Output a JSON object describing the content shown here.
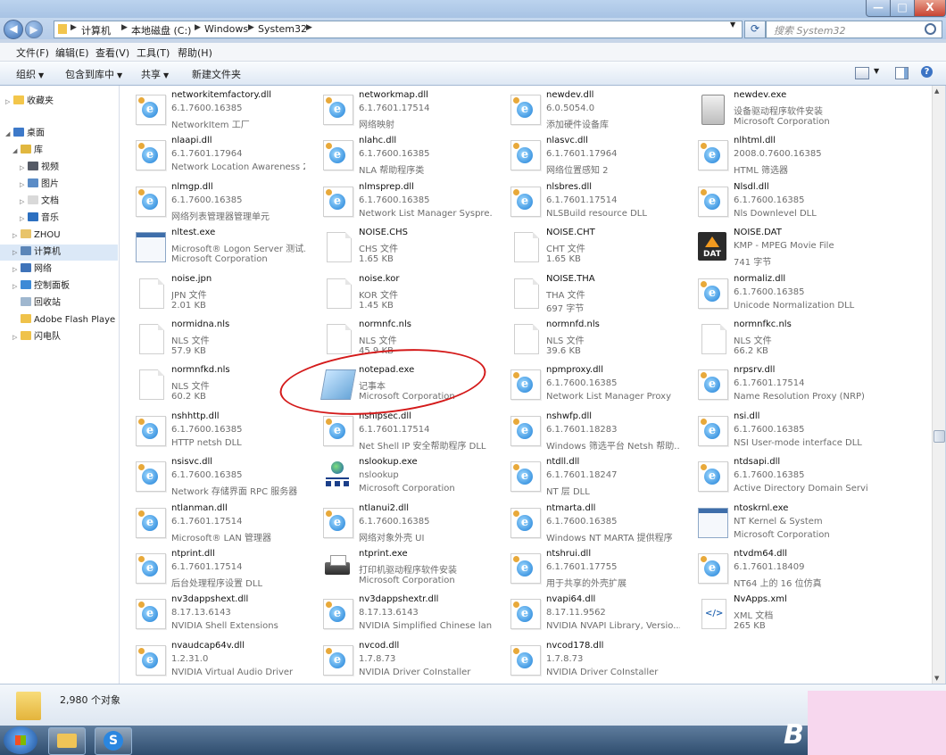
{
  "window": {
    "minimize_label": "—",
    "maximize_label": "□",
    "close_label": "X"
  },
  "address": {
    "crumbs": [
      "计算机",
      "本地磁盘 (C:)",
      "Windows",
      "System32"
    ],
    "search_placeholder": "搜索 System32"
  },
  "menu": [
    "文件(F)",
    "编辑(E)",
    "查看(V)",
    "工具(T)",
    "帮助(H)"
  ],
  "toolbar": {
    "organize": "组织",
    "include_library": "包含到库中",
    "share": "共享",
    "new_folder": "新建文件夹"
  },
  "nav": [
    {
      "label": "收藏夹",
      "icon": "star-icon",
      "color": "#f3c64b"
    },
    {
      "label": "桌面",
      "icon": "desktop-icon",
      "color": "#3d79c9"
    },
    {
      "label": "库",
      "icon": "library-icon",
      "color": "#e1b73f"
    },
    {
      "label": "视频",
      "icon": "video-icon",
      "color": "#555a66"
    },
    {
      "label": "图片",
      "icon": "picture-icon",
      "color": "#5b8cc6"
    },
    {
      "label": "文档",
      "icon": "document-icon",
      "color": "#d9d9d9"
    },
    {
      "label": "音乐",
      "icon": "music-icon",
      "color": "#2c6fc0"
    },
    {
      "label": "ZHOU",
      "icon": "user-icon",
      "color": "#e8c46a"
    },
    {
      "label": "计算机",
      "icon": "computer-icon",
      "color": "#5c86b8"
    },
    {
      "label": "网络",
      "icon": "network-icon",
      "color": "#3f73b9"
    },
    {
      "label": "控制面板",
      "icon": "control-panel-icon",
      "color": "#3d8ad6"
    },
    {
      "label": "回收站",
      "icon": "recycle-bin-icon",
      "color": "#9fb7cf"
    },
    {
      "label": "Adobe Flash Playe",
      "icon": "folder-icon",
      "color": "#efc24a"
    },
    {
      "label": "闪电队",
      "icon": "folder-icon",
      "color": "#efc24a"
    }
  ],
  "files": [
    {
      "name": "networkitemfactory.dll",
      "l2": "6.1.7600.16385",
      "l3": "NetworkItem 工厂",
      "icon": "dll"
    },
    {
      "name": "networkmap.dll",
      "l2": "6.1.7601.17514",
      "l3": "网络映射",
      "icon": "dll"
    },
    {
      "name": "newdev.dll",
      "l2": "6.0.5054.0",
      "l3": "添加硬件设备库",
      "icon": "dll"
    },
    {
      "name": "newdev.exe",
      "l2": "设备驱动程序软件安装",
      "l3": "Microsoft Corporation",
      "icon": "exe"
    },
    {
      "name": "nlaapi.dll",
      "l2": "6.1.7601.17964",
      "l3": "Network Location Awareness 2",
      "icon": "dll"
    },
    {
      "name": "nlahc.dll",
      "l2": "6.1.7600.16385",
      "l3": "NLA 帮助程序类",
      "icon": "dll"
    },
    {
      "name": "nlasvc.dll",
      "l2": "6.1.7601.17964",
      "l3": "网络位置感知 2",
      "icon": "dll"
    },
    {
      "name": "nlhtml.dll",
      "l2": "2008.0.7600.16385",
      "l3": "HTML 筛选器",
      "icon": "dll"
    },
    {
      "name": "nlmgp.dll",
      "l2": "6.1.7600.16385",
      "l3": "网络列表管理器管理单元",
      "icon": "dll"
    },
    {
      "name": "nlmsprep.dll",
      "l2": "6.1.7600.16385",
      "l3": "Network List Manager Syspre...",
      "icon": "dll"
    },
    {
      "name": "nlsbres.dll",
      "l2": "6.1.7601.17514",
      "l3": "NLSBuild resource DLL",
      "icon": "dll"
    },
    {
      "name": "Nlsdl.dll",
      "l2": "6.1.7600.16385",
      "l3": "Nls Downlevel DLL",
      "icon": "dll"
    },
    {
      "name": "nltest.exe",
      "l2": "Microsoft® Logon Server 测试...",
      "l3": "Microsoft Corporation",
      "icon": "win"
    },
    {
      "name": "NOISE.CHS",
      "l2": "CHS 文件",
      "l3": "1.65 KB",
      "icon": "doc"
    },
    {
      "name": "NOISE.CHT",
      "l2": "CHT 文件",
      "l3": "1.65 KB",
      "icon": "doc"
    },
    {
      "name": "NOISE.DAT",
      "l2": "KMP - MPEG Movie File",
      "l3": "741 字节",
      "icon": "dat"
    },
    {
      "name": "noise.jpn",
      "l2": "JPN 文件",
      "l3": "2.01 KB",
      "icon": "doc"
    },
    {
      "name": "noise.kor",
      "l2": "KOR 文件",
      "l3": "1.45 KB",
      "icon": "doc"
    },
    {
      "name": "NOISE.THA",
      "l2": "THA 文件",
      "l3": "697 字节",
      "icon": "doc"
    },
    {
      "name": "normaliz.dll",
      "l2": "6.1.7600.16385",
      "l3": "Unicode Normalization DLL",
      "icon": "dll"
    },
    {
      "name": "normidna.nls",
      "l2": "NLS 文件",
      "l3": "57.9 KB",
      "icon": "doc"
    },
    {
      "name": "normnfc.nls",
      "l2": "NLS 文件",
      "l3": "45.9 KB",
      "icon": "doc"
    },
    {
      "name": "normnfd.nls",
      "l2": "NLS 文件",
      "l3": "39.6 KB",
      "icon": "doc"
    },
    {
      "name": "normnfkc.nls",
      "l2": "NLS 文件",
      "l3": "66.2 KB",
      "icon": "doc"
    },
    {
      "name": "normnfkd.nls",
      "l2": "NLS 文件",
      "l3": "60.2 KB",
      "icon": "doc"
    },
    {
      "name": "notepad.exe",
      "l2": "记事本",
      "l3": "Microsoft Corporation",
      "icon": "note"
    },
    {
      "name": "npmproxy.dll",
      "l2": "6.1.7600.16385",
      "l3": "Network List Manager Proxy",
      "icon": "dll"
    },
    {
      "name": "nrpsrv.dll",
      "l2": "6.1.7601.17514",
      "l3": "Name Resolution Proxy (NRP) ...",
      "icon": "dll"
    },
    {
      "name": "nshhttp.dll",
      "l2": "6.1.7600.16385",
      "l3": "HTTP netsh DLL",
      "icon": "dll"
    },
    {
      "name": "nshipsec.dll",
      "l2": "6.1.7601.17514",
      "l3": "Net Shell IP 安全帮助程序 DLL",
      "icon": "dll"
    },
    {
      "name": "nshwfp.dll",
      "l2": "6.1.7601.18283",
      "l3": "Windows 筛选平台 Netsh 帮助...",
      "icon": "dll"
    },
    {
      "name": "nsi.dll",
      "l2": "6.1.7600.16385",
      "l3": "NSI User-mode interface DLL",
      "icon": "dll"
    },
    {
      "name": "nsisvc.dll",
      "l2": "6.1.7600.16385",
      "l3": "Network 存储界面 RPC 服务器",
      "icon": "dll"
    },
    {
      "name": "nslookup.exe",
      "l2": "nslookup",
      "l3": "Microsoft Corporation",
      "icon": "net"
    },
    {
      "name": "ntdll.dll",
      "l2": "6.1.7601.18247",
      "l3": "NT 层 DLL",
      "icon": "dll"
    },
    {
      "name": "ntdsapi.dll",
      "l2": "6.1.7600.16385",
      "l3": "Active Directory Domain Servic...",
      "icon": "dll"
    },
    {
      "name": "ntlanman.dll",
      "l2": "6.1.7601.17514",
      "l3": "Microsoft® LAN 管理器",
      "icon": "dll"
    },
    {
      "name": "ntlanui2.dll",
      "l2": "6.1.7600.16385",
      "l3": "网络对象外壳 UI",
      "icon": "dll"
    },
    {
      "name": "ntmarta.dll",
      "l2": "6.1.7600.16385",
      "l3": "Windows NT MARTA 提供程序",
      "icon": "dll"
    },
    {
      "name": "ntoskrnl.exe",
      "l2": "NT Kernel & System",
      "l3": "Microsoft Corporation",
      "icon": "win"
    },
    {
      "name": "ntprint.dll",
      "l2": "6.1.7601.17514",
      "l3": "后台处理程序设置 DLL",
      "icon": "dll"
    },
    {
      "name": "ntprint.exe",
      "l2": "打印机驱动程序软件安装",
      "l3": "Microsoft Corporation",
      "icon": "print"
    },
    {
      "name": "ntshrui.dll",
      "l2": "6.1.7601.17755",
      "l3": "用于共享的外壳扩展",
      "icon": "dll"
    },
    {
      "name": "ntvdm64.dll",
      "l2": "6.1.7601.18409",
      "l3": "NT64 上的 16 位仿真",
      "icon": "dll"
    },
    {
      "name": "nv3dappshext.dll",
      "l2": "8.17.13.6143",
      "l3": "NVIDIA Shell Extensions",
      "icon": "dll"
    },
    {
      "name": "nv3dappshextr.dll",
      "l2": "8.17.13.6143",
      "l3": "NVIDIA Simplified Chinese lan...",
      "icon": "dll"
    },
    {
      "name": "nvapi64.dll",
      "l2": "8.17.11.9562",
      "l3": "NVIDIA NVAPI Library, Versio...",
      "icon": "dll"
    },
    {
      "name": "NvApps.xml",
      "l2": "XML 文档",
      "l3": "265 KB",
      "icon": "xml"
    },
    {
      "name": "nvaudcap64v.dll",
      "l2": "1.2.31.0",
      "l3": "NVIDIA Virtual Audio Driver",
      "icon": "dll"
    },
    {
      "name": "nvcod.dll",
      "l2": "1.7.8.73",
      "l3": "NVIDIA Driver CoInstaller",
      "icon": "dll"
    },
    {
      "name": "nvcod178.dll",
      "l2": "1.7.8.73",
      "l3": "NVIDIA Driver CoInstaller",
      "icon": "dll"
    }
  ],
  "status": {
    "count": "2,980 个对象"
  }
}
